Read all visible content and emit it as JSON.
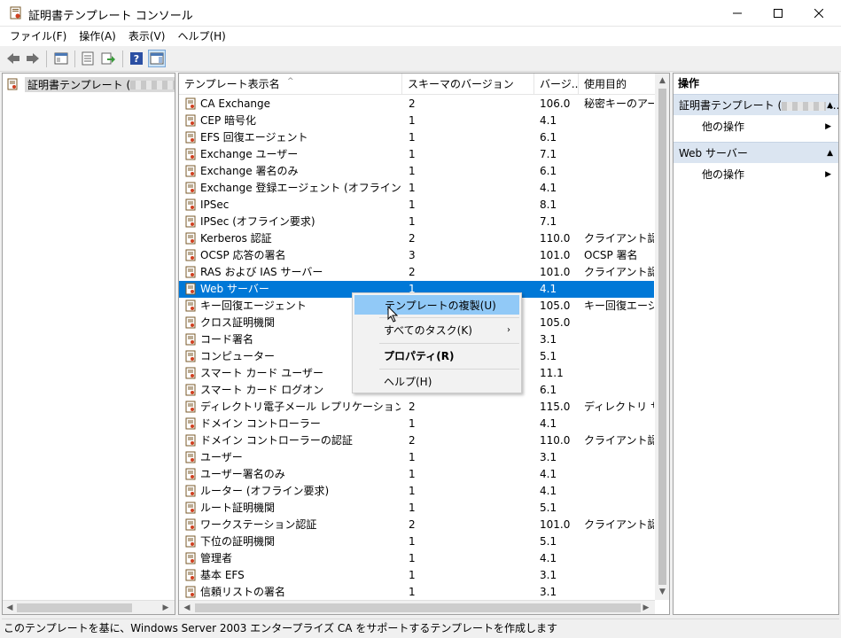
{
  "window": {
    "title": "証明書テンプレート コンソール"
  },
  "menu": [
    {
      "label": "ファイル(F)"
    },
    {
      "label": "操作(A)"
    },
    {
      "label": "表示(V)"
    },
    {
      "label": "ヘルプ(H)"
    }
  ],
  "tree": {
    "root_label": "証明書テンプレート ("
  },
  "columns": {
    "name": "テンプレート表示名",
    "schema": "スキーマのバージョン",
    "version": "バージ...",
    "purpose": "使用目的"
  },
  "rows": [
    {
      "name": "CA Exchange",
      "schema": "2",
      "version": "106.0",
      "purpose": "秘密キーのアーカ"
    },
    {
      "name": "CEP 暗号化",
      "schema": "1",
      "version": "4.1",
      "purpose": ""
    },
    {
      "name": "EFS 回復エージェント",
      "schema": "1",
      "version": "6.1",
      "purpose": ""
    },
    {
      "name": "Exchange ユーザー",
      "schema": "1",
      "version": "7.1",
      "purpose": ""
    },
    {
      "name": "Exchange 署名のみ",
      "schema": "1",
      "version": "6.1",
      "purpose": ""
    },
    {
      "name": "Exchange 登録エージェント (オフライン要求)",
      "schema": "1",
      "version": "4.1",
      "purpose": ""
    },
    {
      "name": "IPSec",
      "schema": "1",
      "version": "8.1",
      "purpose": ""
    },
    {
      "name": "IPSec (オフライン要求)",
      "schema": "1",
      "version": "7.1",
      "purpose": ""
    },
    {
      "name": "Kerberos 認証",
      "schema": "2",
      "version": "110.0",
      "purpose": "クライアント認証"
    },
    {
      "name": "OCSP 応答の署名",
      "schema": "3",
      "version": "101.0",
      "purpose": "OCSP 署名"
    },
    {
      "name": "RAS および IAS サーバー",
      "schema": "2",
      "version": "101.0",
      "purpose": "クライアント認証"
    },
    {
      "name": "Web サーバー",
      "schema": "1",
      "version": "4.1",
      "purpose": ""
    },
    {
      "name": "キー回復エージェント",
      "schema": "",
      "version": "105.0",
      "purpose": "キー回復エージェ"
    },
    {
      "name": "クロス証明機関",
      "schema": "",
      "version": "105.0",
      "purpose": ""
    },
    {
      "name": "コード署名",
      "schema": "",
      "version": "3.1",
      "purpose": ""
    },
    {
      "name": "コンピューター",
      "schema": "",
      "version": "5.1",
      "purpose": ""
    },
    {
      "name": "スマート カード ユーザー",
      "schema": "",
      "version": "11.1",
      "purpose": ""
    },
    {
      "name": "スマート カード ログオン",
      "schema": "",
      "version": "6.1",
      "purpose": ""
    },
    {
      "name": "ディレクトリ電子メール レプリケーション",
      "schema": "2",
      "version": "115.0",
      "purpose": "ディレクトリ サービ"
    },
    {
      "name": "ドメイン コントローラー",
      "schema": "1",
      "version": "4.1",
      "purpose": ""
    },
    {
      "name": "ドメイン コントローラーの認証",
      "schema": "2",
      "version": "110.0",
      "purpose": "クライアント認証"
    },
    {
      "name": "ユーザー",
      "schema": "1",
      "version": "3.1",
      "purpose": ""
    },
    {
      "name": "ユーザー署名のみ",
      "schema": "1",
      "version": "4.1",
      "purpose": ""
    },
    {
      "name": "ルーター (オフライン要求)",
      "schema": "1",
      "version": "4.1",
      "purpose": ""
    },
    {
      "name": "ルート証明機関",
      "schema": "1",
      "version": "5.1",
      "purpose": ""
    },
    {
      "name": "ワークステーション認証",
      "schema": "2",
      "version": "101.0",
      "purpose": "クライアント認証"
    },
    {
      "name": "下位の証明機関",
      "schema": "1",
      "version": "5.1",
      "purpose": ""
    },
    {
      "name": "管理者",
      "schema": "1",
      "version": "4.1",
      "purpose": ""
    },
    {
      "name": "基本 EFS",
      "schema": "1",
      "version": "3.1",
      "purpose": ""
    },
    {
      "name": "信頼リストの署名",
      "schema": "1",
      "version": "3.1",
      "purpose": ""
    }
  ],
  "selected_row": "Web サーバー",
  "context_menu": {
    "duplicate": "テンプレートの複製(U)",
    "all_tasks": "すべてのタスク(K)",
    "properties": "プロパティ(R)",
    "help": "ヘルプ(H)"
  },
  "actions": {
    "title": "操作",
    "section1": "証明書テンプレート (",
    "section1_suffix": "...",
    "section1_more": "他の操作",
    "section2": "Web サーバー",
    "section2_more": "他の操作"
  },
  "status": "このテンプレートを基に、Windows Server 2003 エンタープライズ CA をサポートするテンプレートを作成します",
  "colors": {
    "selection": "#0078d7",
    "menu_highlight": "#91c9f7",
    "action_header": "#dbe5f1"
  }
}
